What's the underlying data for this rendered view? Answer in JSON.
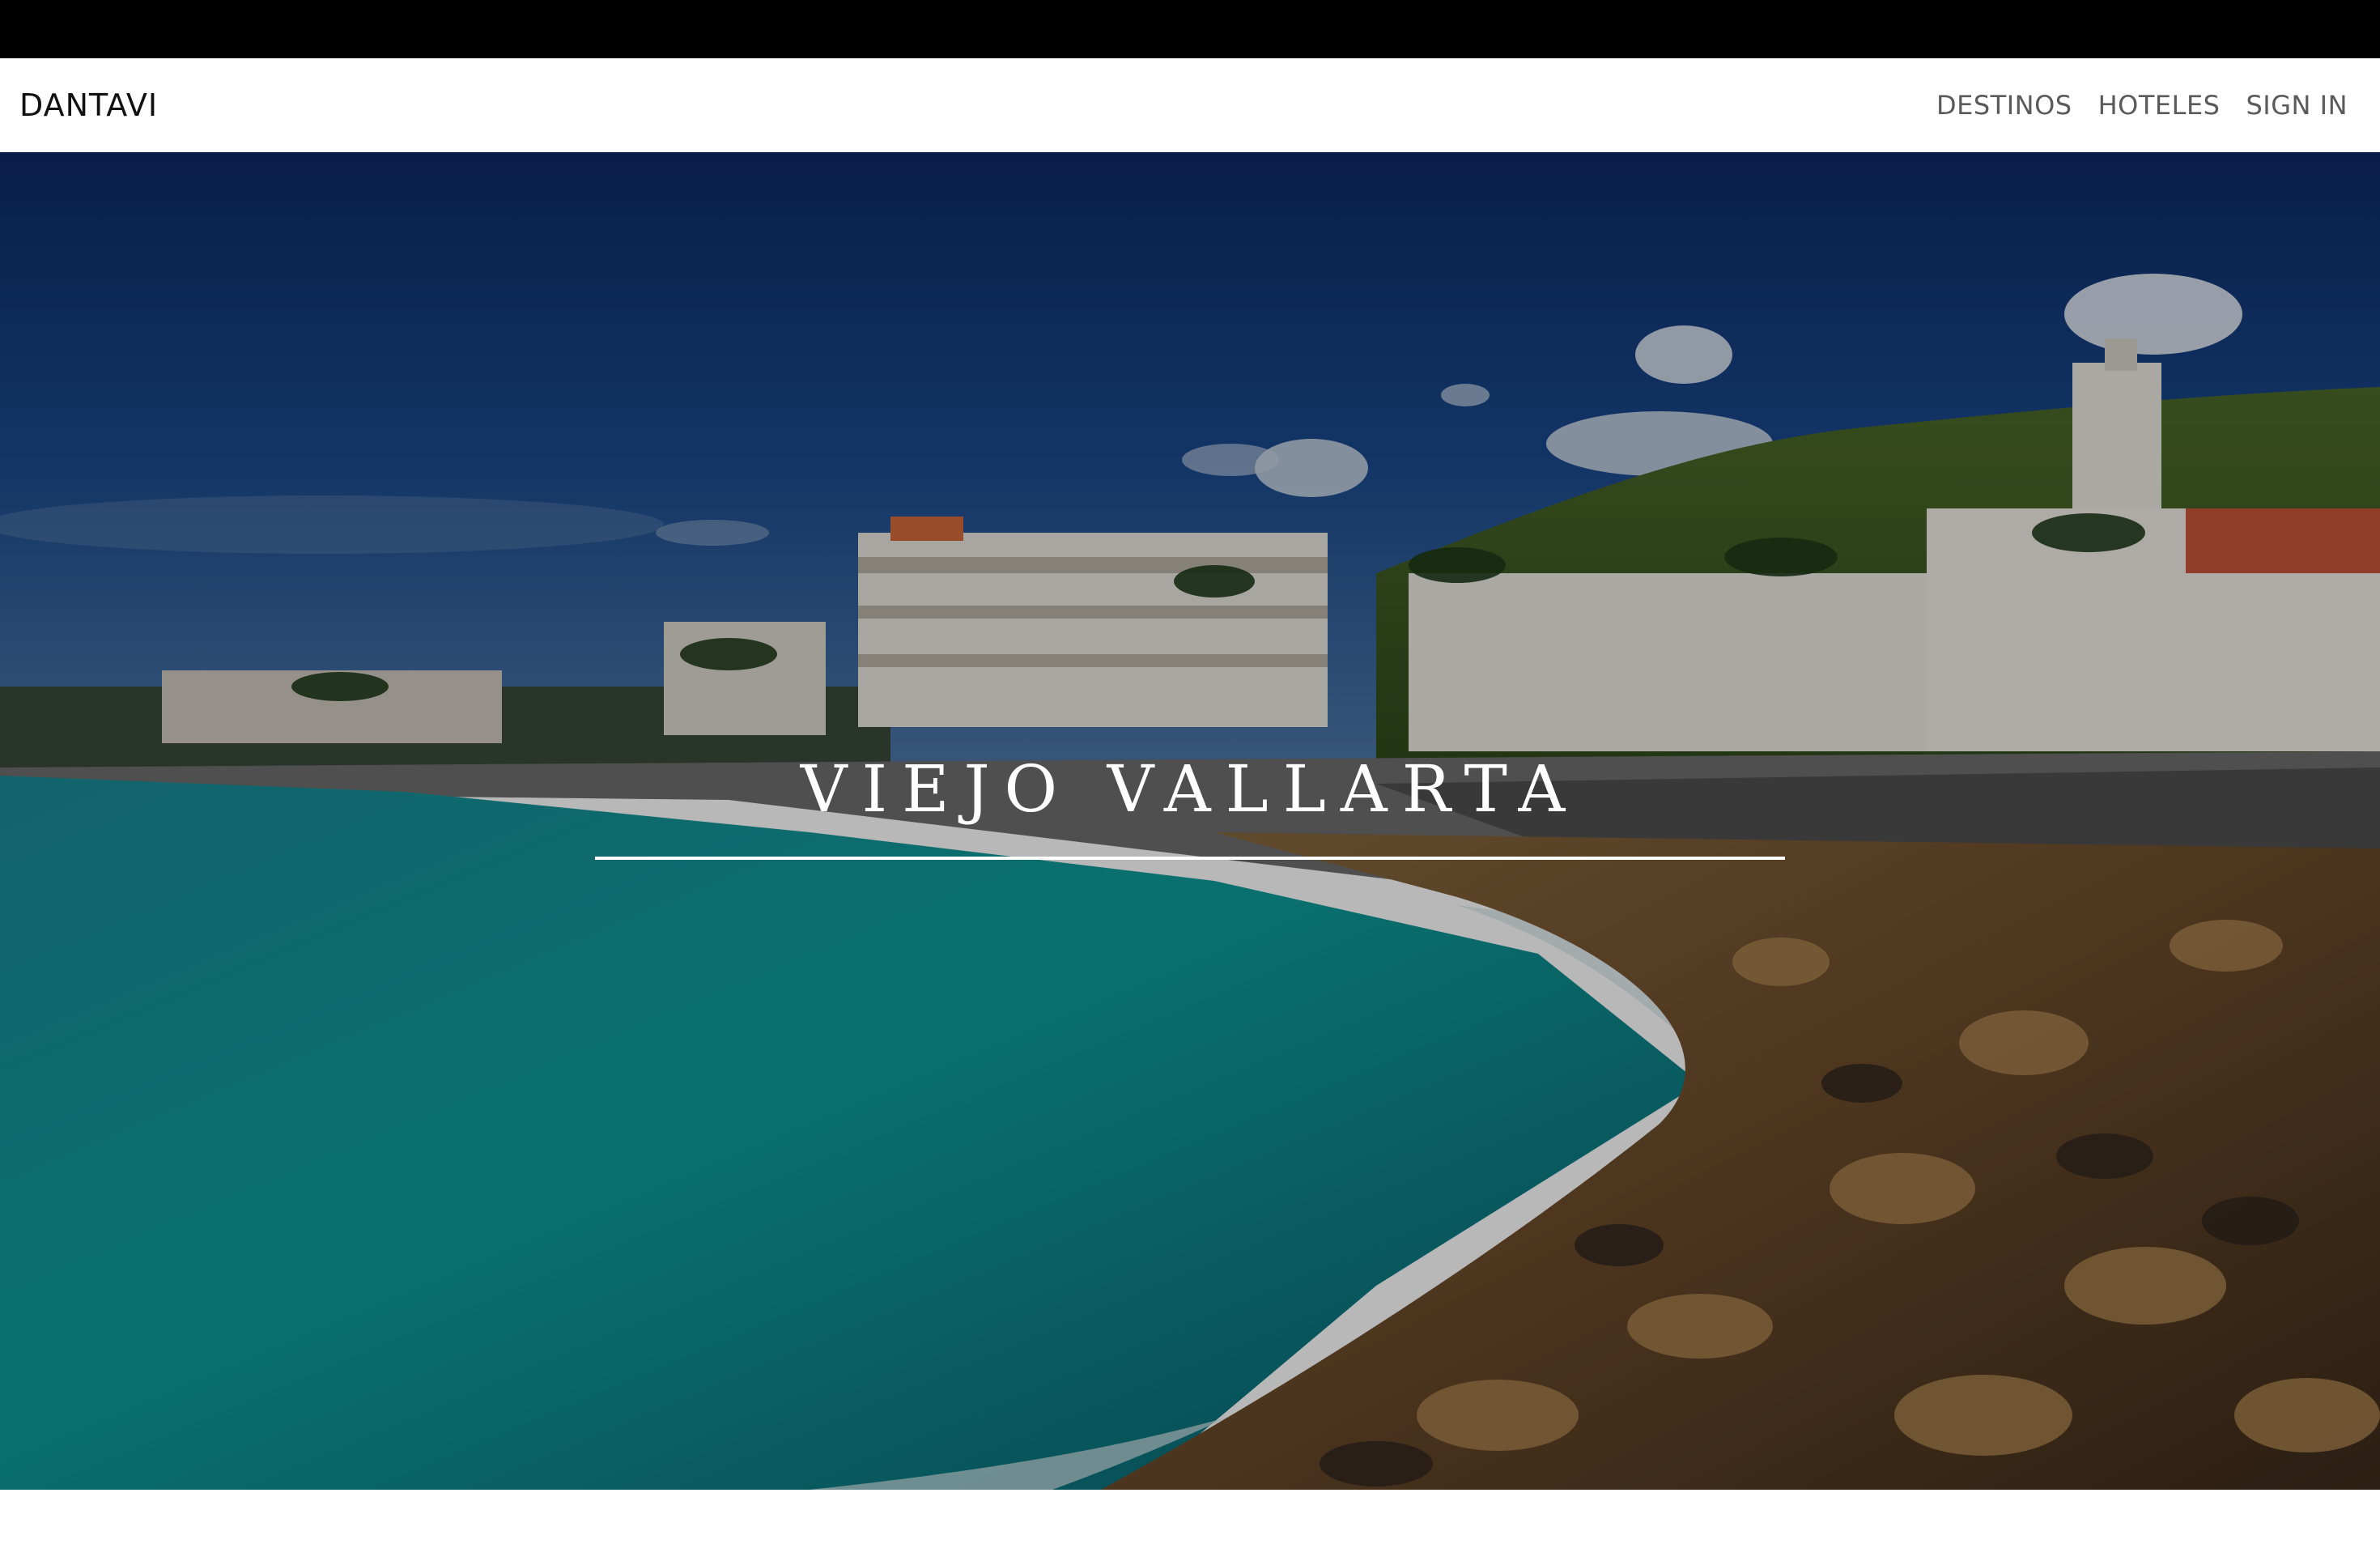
{
  "brand": "DANTAVI",
  "nav": {
    "items": [
      {
        "label": "DESTINOS"
      },
      {
        "label": "HOTELES"
      },
      {
        "label": "SIGN IN"
      }
    ]
  },
  "hero": {
    "title": "VIEJO VALLARTA",
    "image": "seaside-town-photo"
  },
  "colors": {
    "topbar": "#000000",
    "navbar": "#ffffff",
    "nav_text": "#5a5a5a",
    "hero_text": "#ffffff"
  }
}
